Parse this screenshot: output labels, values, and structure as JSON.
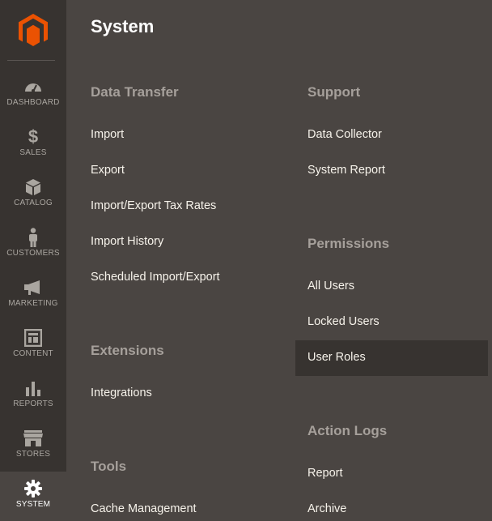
{
  "sidebar": {
    "items": [
      {
        "label": "DASHBOARD",
        "icon": "dashboard-icon"
      },
      {
        "label": "SALES",
        "icon": "dollar-icon"
      },
      {
        "label": "CATALOG",
        "icon": "box-icon"
      },
      {
        "label": "CUSTOMERS",
        "icon": "person-icon"
      },
      {
        "label": "MARKETING",
        "icon": "megaphone-icon"
      },
      {
        "label": "CONTENT",
        "icon": "layout-icon"
      },
      {
        "label": "REPORTS",
        "icon": "bar-chart-icon"
      },
      {
        "label": "STORES",
        "icon": "storefront-icon"
      },
      {
        "label": "SYSTEM",
        "icon": "gear-icon"
      }
    ],
    "active": "SYSTEM"
  },
  "panel": {
    "title": "System",
    "sections": {
      "data_transfer": {
        "title": "Data Transfer",
        "links": [
          "Import",
          "Export",
          "Import/Export Tax Rates",
          "Import History",
          "Scheduled Import/Export"
        ]
      },
      "extensions": {
        "title": "Extensions",
        "links": [
          "Integrations"
        ]
      },
      "tools": {
        "title": "Tools",
        "links": [
          "Cache Management"
        ]
      },
      "support": {
        "title": "Support",
        "links": [
          "Data Collector",
          "System Report"
        ]
      },
      "permissions": {
        "title": "Permissions",
        "links": [
          "All Users",
          "Locked Users",
          "User Roles"
        ]
      },
      "action_logs": {
        "title": "Action Logs",
        "links": [
          "Report",
          "Archive"
        ]
      }
    },
    "highlighted_link": "User Roles"
  },
  "colors": {
    "sidebar_bg": "#373330",
    "panel_bg": "#4a4542",
    "logo_orange": "#eb5202",
    "section_title": "#a6a09b",
    "link_text": "#f7f3eb"
  }
}
